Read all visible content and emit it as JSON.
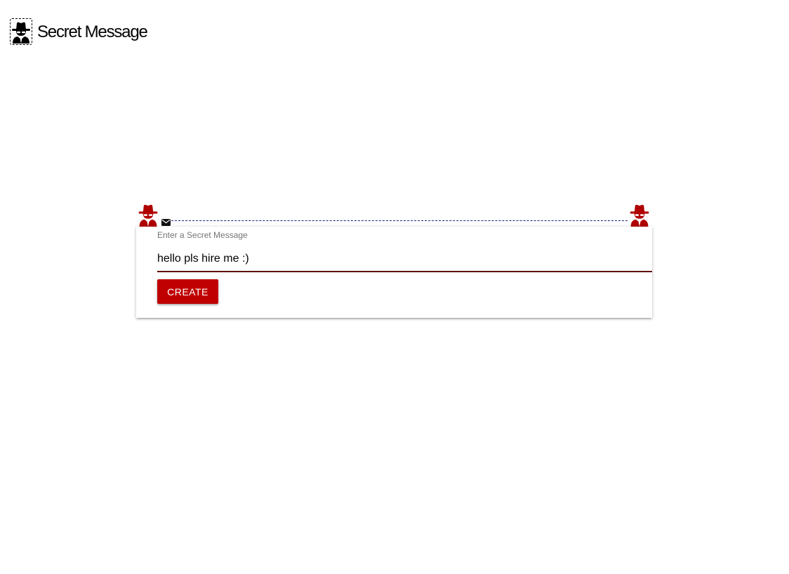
{
  "app": {
    "title": "Secret Message",
    "logo_icon": "user-secret-icon"
  },
  "decorations": {
    "left_icon": "user-secret-icon",
    "right_icon": "user-secret-icon",
    "envelope_icon": "envelope-icon",
    "spy_color": "#b00000",
    "line_color": "#1a237e"
  },
  "form": {
    "label": "Enter a Secret Message",
    "message_value": "hello pls hire me :)",
    "underline_color": "#5d0d0d",
    "button_label": "CREATE",
    "button_color": "#c00000"
  }
}
